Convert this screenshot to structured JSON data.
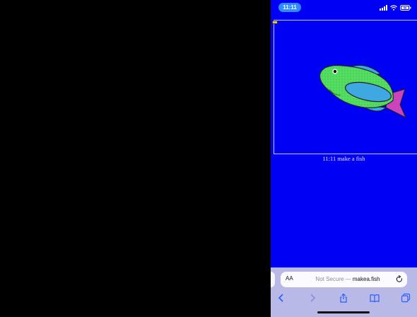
{
  "status_bar": {
    "time": "11:11",
    "battery_level": "59"
  },
  "page": {
    "caption": "11:11 make a fish"
  },
  "safari": {
    "aa_label": "AA",
    "url_prefix": "Not Secure — ",
    "url_host": "makea.fish"
  },
  "icons": [
    "signal-icon",
    "wifi-icon",
    "battery-icon",
    "reload-icon",
    "back-icon",
    "forward-icon",
    "share-icon",
    "bookmarks-icon",
    "tabs-icon"
  ],
  "colors": {
    "page_background": "#0000f5",
    "toolbar_background": "#b9b9e8",
    "time_pill": "#2f8cff",
    "fish_body": "#55e055",
    "fish_tail": "#cc44bb"
  }
}
